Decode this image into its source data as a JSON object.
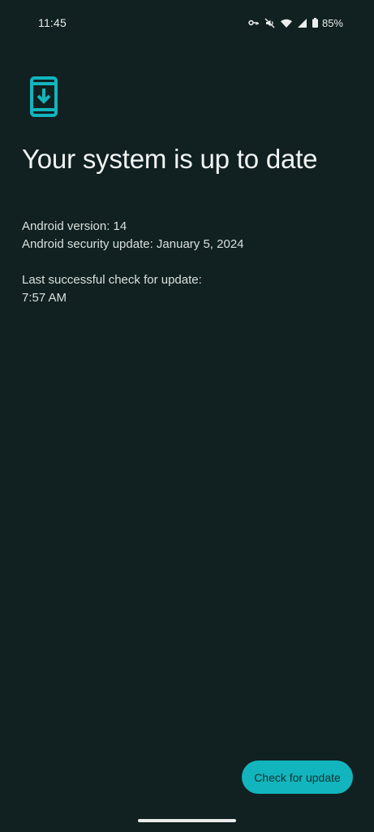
{
  "status_bar": {
    "time": "11:45",
    "battery_percent": "85%",
    "icons": [
      "vpn-key-icon",
      "mute-icon",
      "wifi-icon",
      "cell-signal-icon",
      "battery-icon"
    ]
  },
  "header": {
    "icon": "system-update-icon",
    "title": "Your system is up to date"
  },
  "info": {
    "android_version": "Android version: 14",
    "security_update": "Android security update: January 5, 2024",
    "last_check_label": "Last successful check for update:",
    "last_check_time": "7:57 AM"
  },
  "actions": {
    "check_label": "Check for update"
  },
  "colors": {
    "background": "#112020",
    "accent": "#12b5bd",
    "text": "#f1f5f3"
  }
}
